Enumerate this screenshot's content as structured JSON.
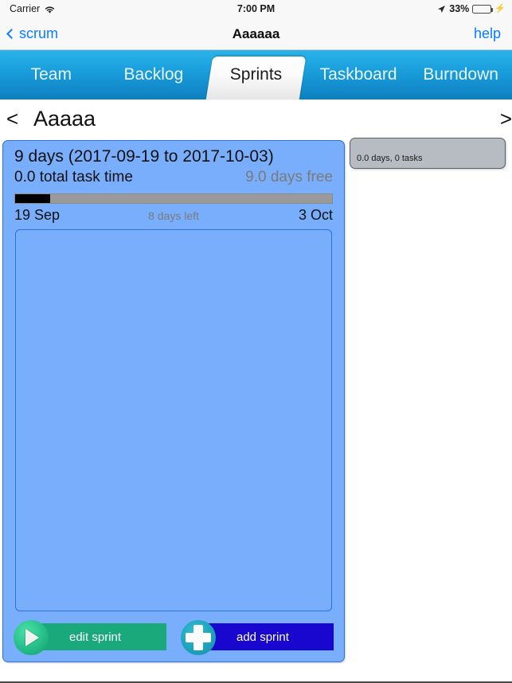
{
  "status_bar": {
    "carrier": "Carrier",
    "wifi_icon": "wifi-icon",
    "time": "7:00 PM",
    "location_icon": "location-arrow-icon",
    "battery_percent": "33%",
    "battery_level": 33,
    "battery_icon": "battery-icon",
    "charging_icon": "lightning-bolt-icon"
  },
  "nav_bar": {
    "back_label": "scrum",
    "back_icon": "chevron-left-icon",
    "title": "Aaaaaa",
    "help_label": "help"
  },
  "tab_bar": {
    "tabs": [
      {
        "label": "Team",
        "active": false
      },
      {
        "label": "Backlog",
        "active": false
      },
      {
        "label": "Sprints",
        "active": true
      },
      {
        "label": "Taskboard",
        "active": false
      },
      {
        "label": "Burndown",
        "active": false
      }
    ]
  },
  "sprint_nav": {
    "prev_icon": "<",
    "title": "Aaaaa",
    "next_icon": ">"
  },
  "sprint_card": {
    "duration_and_range": "9 days (2017-09-19 to 2017-10-03)",
    "total_task_time": "0.0 total task time",
    "days_free": "9.0 days free",
    "progress_percent": 11,
    "start_date": "19 Sep",
    "days_left": "8 days left",
    "end_date": "3 Oct",
    "tasks": [],
    "actions": {
      "edit": {
        "label": "edit sprint",
        "icon": "play-icon",
        "color": "#1aa97b"
      },
      "add": {
        "label": "add sprint",
        "icon": "plus-icon",
        "color": "#1a07cf"
      }
    }
  },
  "side_panel": {
    "summary": "0.0 days, 0 tasks"
  },
  "colors": {
    "card_blue": "#78aefc",
    "card_border": "#2f6fd8",
    "tab_blue_top": "#2bb3e8",
    "tab_blue_bottom": "#0e7fc0",
    "link_blue": "#0a7cff",
    "panel_gray": "#b6bcc2",
    "progress_fill": "#000000",
    "progress_track": "#9a9a9a"
  }
}
